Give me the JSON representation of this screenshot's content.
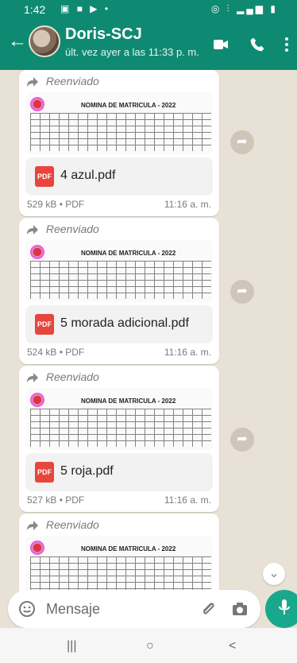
{
  "status": {
    "time": "1:42",
    "left_icons": [
      "gallery-icon",
      "facebook-icon",
      "play-icon",
      "dot"
    ],
    "right_icons": [
      "alarm-icon",
      "vibrate-icon",
      "signal-icon",
      "battery-icon"
    ]
  },
  "header": {
    "contact_name": "Doris-SCJ",
    "last_seen": "últ. vez ayer a las 11:33 p. m."
  },
  "colors": {
    "header_green": "#0f8a72",
    "mic_green": "#1aa88c",
    "chat_bg": "#e8e1d6"
  },
  "messages": [
    {
      "forwarded_label": "Reenviado",
      "thumb_title": "NOMINA DE MATRICULA - 2022",
      "file_name": "4 azul.pdf",
      "file_meta": "529 kB • PDF",
      "time": "11:16 a. m."
    },
    {
      "forwarded_label": "Reenviado",
      "thumb_title": "NOMINA DE MATRICULA - 2022",
      "file_name": "5 morada adicional.pdf",
      "file_meta": "524 kB • PDF",
      "time": "11:16 a. m."
    },
    {
      "forwarded_label": "Reenviado",
      "thumb_title": "NOMINA DE MATRICULA - 2022",
      "file_name": "5 roja.pdf",
      "file_meta": "527 kB • PDF",
      "time": "11:16 a. m."
    },
    {
      "forwarded_label": "Reenviado",
      "thumb_title": "NOMINA DE MATRICULA - 2022"
    }
  ],
  "composer": {
    "placeholder": "Mensaje"
  },
  "nav": {
    "recent": "|||",
    "home": "○",
    "back": "<"
  }
}
